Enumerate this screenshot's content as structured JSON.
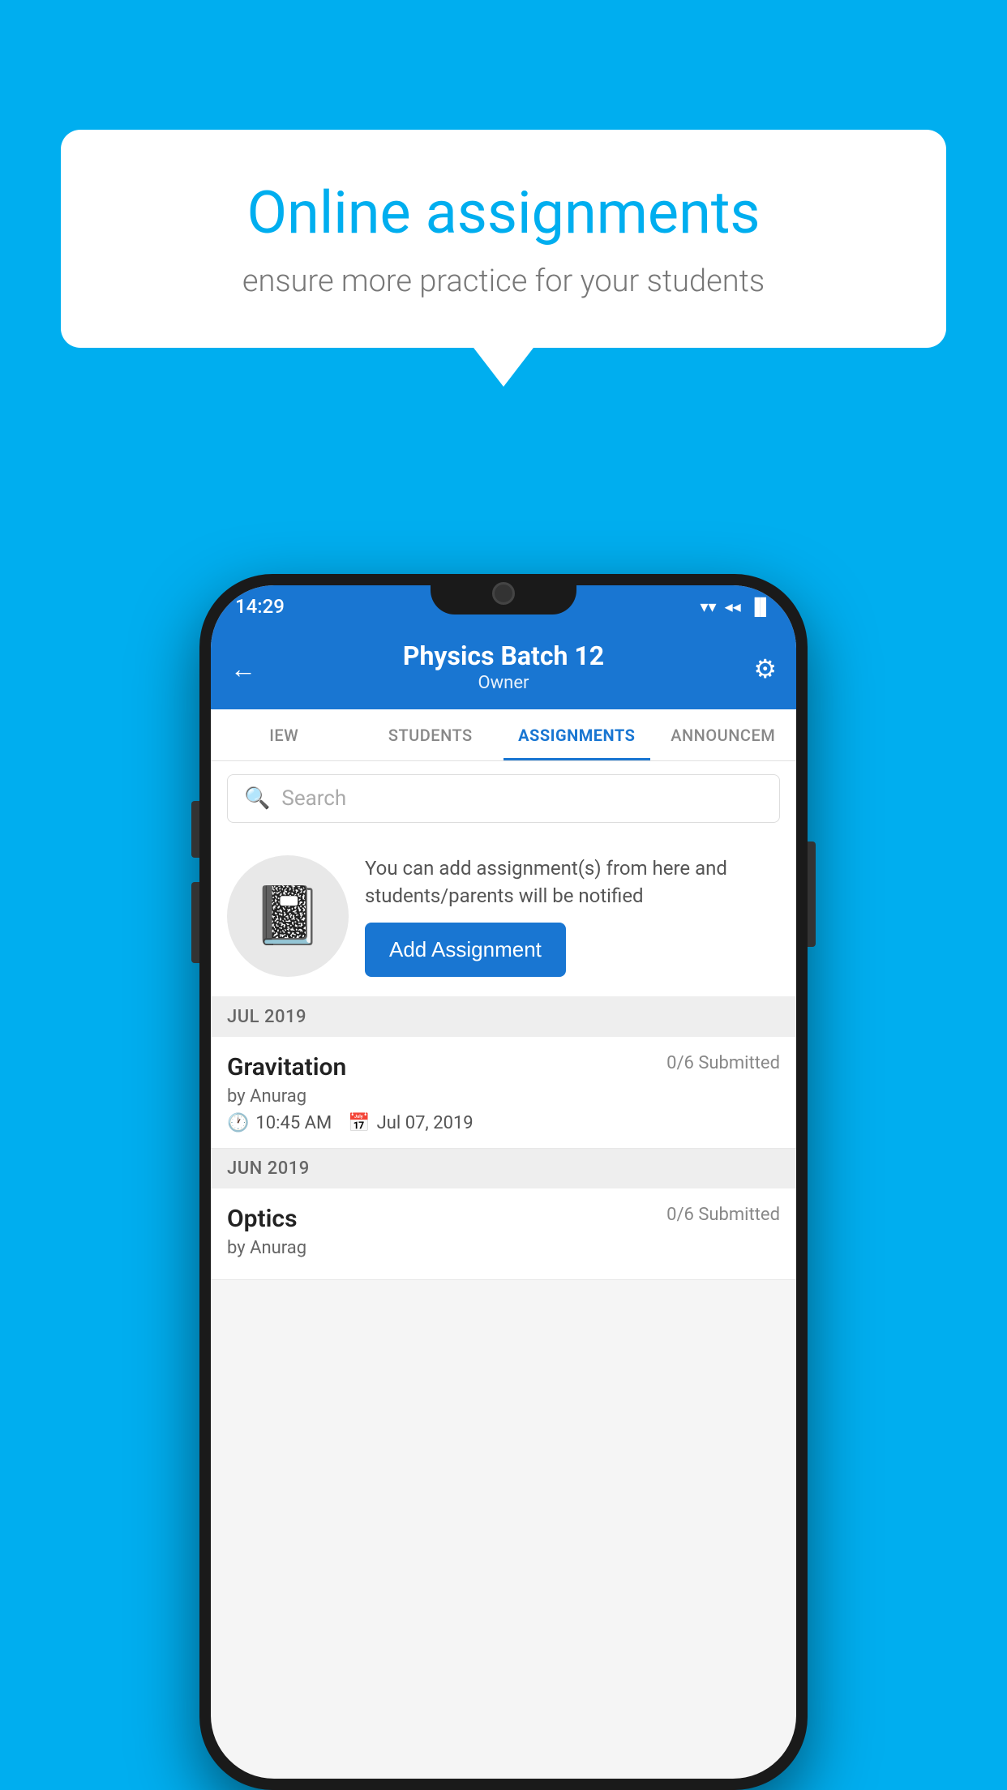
{
  "background_color": "#00AEEF",
  "speech_bubble": {
    "title": "Online assignments",
    "subtitle": "ensure more practice for your students"
  },
  "status_bar": {
    "time": "14:29",
    "wifi": "▼",
    "signal": "◀",
    "battery": "▐"
  },
  "header": {
    "title": "Physics Batch 12",
    "subtitle": "Owner",
    "back_label": "←",
    "settings_label": "⚙"
  },
  "tabs": [
    {
      "label": "IEW",
      "active": false
    },
    {
      "label": "STUDENTS",
      "active": false
    },
    {
      "label": "ASSIGNMENTS",
      "active": true
    },
    {
      "label": "ANNOUNCEM...",
      "active": false
    }
  ],
  "search": {
    "placeholder": "Search"
  },
  "promo": {
    "text": "You can add assignment(s) from here and students/parents will be notified",
    "button_label": "Add Assignment"
  },
  "sections": [
    {
      "label": "JUL 2019",
      "assignments": [
        {
          "name": "Gravitation",
          "submitted": "0/6 Submitted",
          "author": "by Anurag",
          "time": "10:45 AM",
          "date": "Jul 07, 2019"
        }
      ]
    },
    {
      "label": "JUN 2019",
      "assignments": [
        {
          "name": "Optics",
          "submitted": "0/6 Submitted",
          "author": "by Anurag",
          "time": "",
          "date": ""
        }
      ]
    }
  ]
}
